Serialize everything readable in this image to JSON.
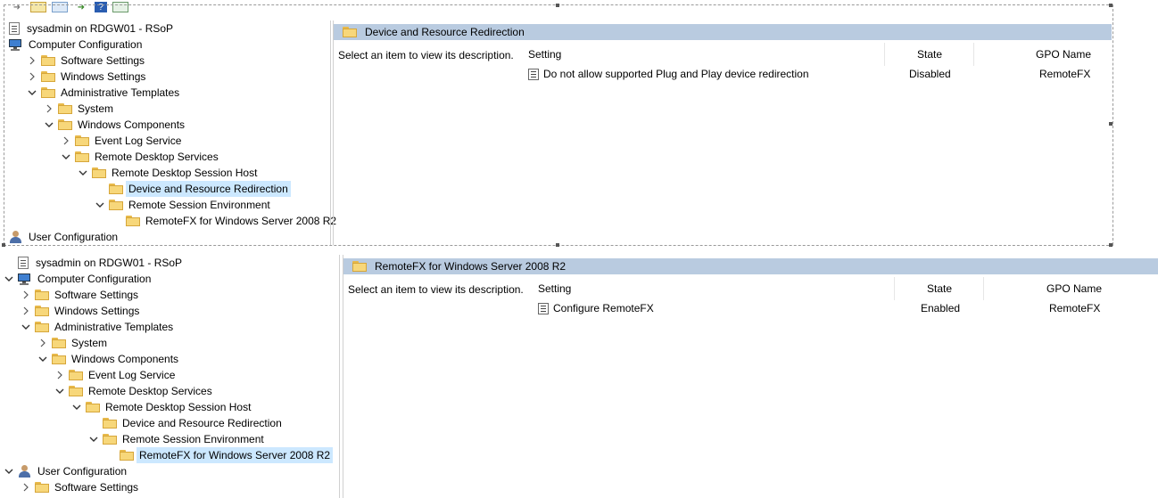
{
  "toolbar": {
    "buttons": [
      "back-icon",
      "up-icon",
      "show-hide-tree-icon",
      "export-icon",
      "help-icon",
      "action-pane-icon"
    ]
  },
  "top": {
    "tree": [
      {
        "label": "sysadmin on RDGW01 - RSoP",
        "icon": "rsop-doc-icon",
        "chev": "none",
        "level": 0
      },
      {
        "label": "Computer Configuration",
        "icon": "computer-icon",
        "chev": "none",
        "level": 0
      },
      {
        "label": "Software Settings",
        "icon": "folder-icon",
        "chev": "right",
        "level": 1
      },
      {
        "label": "Windows Settings",
        "icon": "folder-icon",
        "chev": "right",
        "level": 1
      },
      {
        "label": "Administrative Templates",
        "icon": "folder-icon",
        "chev": "down",
        "level": 1
      },
      {
        "label": "System",
        "icon": "folder-icon",
        "chev": "right",
        "level": 2
      },
      {
        "label": "Windows Components",
        "icon": "folder-icon",
        "chev": "down",
        "level": 2
      },
      {
        "label": "Event Log Service",
        "icon": "folder-icon",
        "chev": "right",
        "level": 3
      },
      {
        "label": "Remote Desktop Services",
        "icon": "folder-icon",
        "chev": "down",
        "level": 3
      },
      {
        "label": "Remote Desktop Session Host",
        "icon": "folder-icon",
        "chev": "down",
        "level": 4
      },
      {
        "label": "Device and Resource Redirection",
        "icon": "folder-icon",
        "chev": "none",
        "level": 5,
        "selected": true
      },
      {
        "label": "Remote Session Environment",
        "icon": "folder-icon",
        "chev": "down",
        "level": 5
      },
      {
        "label": "RemoteFX for Windows Server 2008 R2",
        "icon": "folder-icon",
        "chev": "none",
        "level": 6
      },
      {
        "label": "User Configuration",
        "icon": "user-icon",
        "chev": "none",
        "level": 0
      }
    ],
    "header_title": "Device and Resource Redirection",
    "description": "Select an item to view its description.",
    "columns": {
      "setting": "Setting",
      "state": "State",
      "gpo": "GPO Name"
    },
    "rows": [
      {
        "setting": "Do not allow supported Plug and Play device redirection",
        "state": "Disabled",
        "gpo": "RemoteFX"
      }
    ]
  },
  "bottom": {
    "tree": [
      {
        "label": "sysadmin on RDGW01 - RSoP",
        "icon": "rsop-doc-icon",
        "chev": "none",
        "level": 0
      },
      {
        "label": "Computer Configuration",
        "icon": "computer-icon",
        "chev": "down",
        "level": 0
      },
      {
        "label": "Software Settings",
        "icon": "folder-icon",
        "chev": "right",
        "level": 1
      },
      {
        "label": "Windows Settings",
        "icon": "folder-icon",
        "chev": "right",
        "level": 1
      },
      {
        "label": "Administrative Templates",
        "icon": "folder-icon",
        "chev": "down",
        "level": 1
      },
      {
        "label": "System",
        "icon": "folder-icon",
        "chev": "right",
        "level": 2
      },
      {
        "label": "Windows Components",
        "icon": "folder-icon",
        "chev": "down",
        "level": 2
      },
      {
        "label": "Event Log Service",
        "icon": "folder-icon",
        "chev": "right",
        "level": 3
      },
      {
        "label": "Remote Desktop Services",
        "icon": "folder-icon",
        "chev": "down",
        "level": 3
      },
      {
        "label": "Remote Desktop Session Host",
        "icon": "folder-icon",
        "chev": "down",
        "level": 4
      },
      {
        "label": "Device and Resource Redirection",
        "icon": "folder-icon",
        "chev": "none",
        "level": 5
      },
      {
        "label": "Remote Session Environment",
        "icon": "folder-icon",
        "chev": "down",
        "level": 5
      },
      {
        "label": "RemoteFX for Windows Server 2008 R2",
        "icon": "folder-icon",
        "chev": "none",
        "level": 6,
        "selected": true
      },
      {
        "label": "User Configuration",
        "icon": "user-icon",
        "chev": "down",
        "level": 0
      },
      {
        "label": "Software Settings",
        "icon": "folder-icon",
        "chev": "right",
        "level": 1
      }
    ],
    "header_title": "RemoteFX for Windows Server 2008 R2",
    "description": "Select an item to view its description.",
    "columns": {
      "setting": "Setting",
      "state": "State",
      "gpo": "GPO Name"
    },
    "rows": [
      {
        "setting": "Configure RemoteFX",
        "state": "Enabled",
        "gpo": "RemoteFX"
      }
    ]
  },
  "colors": {
    "selection": "#cce8ff",
    "header_band": "#b9cbe0",
    "folder": "#f7d77a"
  }
}
